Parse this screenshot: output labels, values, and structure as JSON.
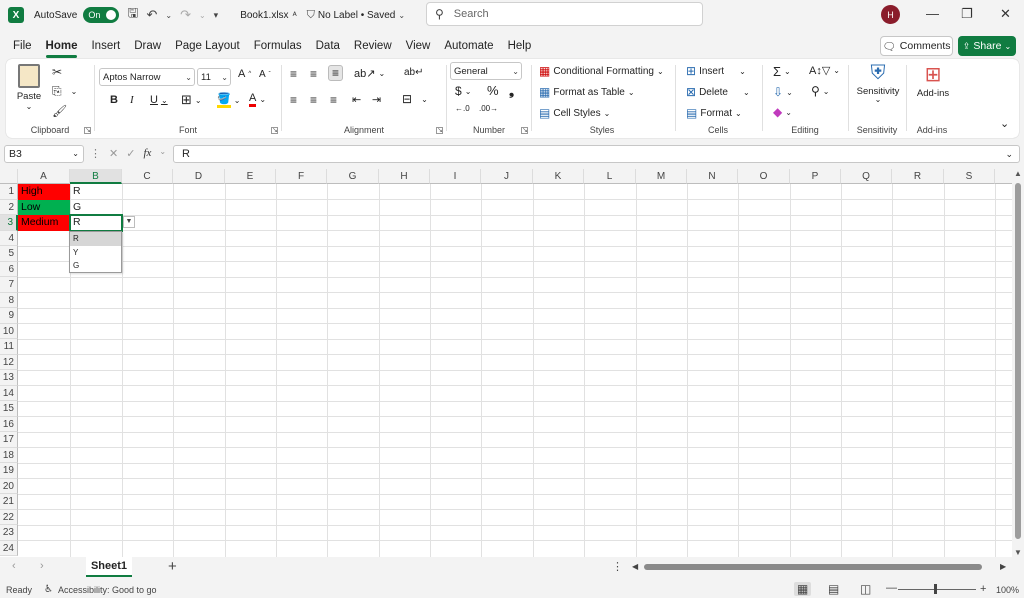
{
  "titlebar": {
    "autosave_label": "AutoSave",
    "autosave_state": "On",
    "filename": "Book1.xlsx",
    "label_status": "No Label • Saved",
    "search_placeholder": "Search",
    "avatar_initial": "H"
  },
  "tabs": [
    "File",
    "Home",
    "Insert",
    "Draw",
    "Page Layout",
    "Formulas",
    "Data",
    "Review",
    "View",
    "Automate",
    "Help"
  ],
  "active_tab": "Home",
  "actions": {
    "comments": "Comments",
    "share": "Share"
  },
  "ribbon": {
    "clipboard": {
      "label": "Clipboard",
      "paste": "Paste"
    },
    "font": {
      "label": "Font",
      "font_name": "Aptos Narrow",
      "font_size": "11"
    },
    "alignment": {
      "label": "Alignment"
    },
    "number": {
      "label": "Number",
      "format": "General"
    },
    "styles": {
      "label": "Styles",
      "conditional": "Conditional Formatting",
      "format_table": "Format as Table",
      "cell_styles": "Cell Styles"
    },
    "cells": {
      "label": "Cells",
      "insert": "Insert",
      "delete": "Delete",
      "format": "Format"
    },
    "editing": {
      "label": "Editing"
    },
    "sensitivity": {
      "label": "Sensitivity",
      "button": "Sensitivity"
    },
    "addins": {
      "label": "Add-ins",
      "button": "Add-ins"
    }
  },
  "formula_bar": {
    "name_box": "B3",
    "content": "R"
  },
  "columns": [
    "A",
    "B",
    "C",
    "D",
    "E",
    "F",
    "G",
    "H",
    "I",
    "J",
    "K",
    "L",
    "M",
    "N",
    "O",
    "P",
    "Q",
    "R",
    "S"
  ],
  "rows": [
    "1",
    "2",
    "3",
    "4",
    "5",
    "6",
    "7",
    "8",
    "9",
    "10",
    "11",
    "12",
    "13",
    "14",
    "15",
    "16",
    "17",
    "18",
    "19",
    "20",
    "21",
    "22",
    "23",
    "24"
  ],
  "cells": {
    "A1": "High",
    "B1": "R",
    "A2": "Low",
    "B2": "G",
    "A3": "Medium",
    "B3": "R"
  },
  "cell_colors": {
    "red": "#ff0000",
    "green": "#00b050"
  },
  "dropdown_options": [
    "R",
    "Y",
    "G"
  ],
  "sheet_tab": "Sheet1",
  "status": {
    "ready": "Ready",
    "accessibility": "Accessibility: Good to go",
    "zoom": "100%"
  },
  "accent_color": "#107c41"
}
